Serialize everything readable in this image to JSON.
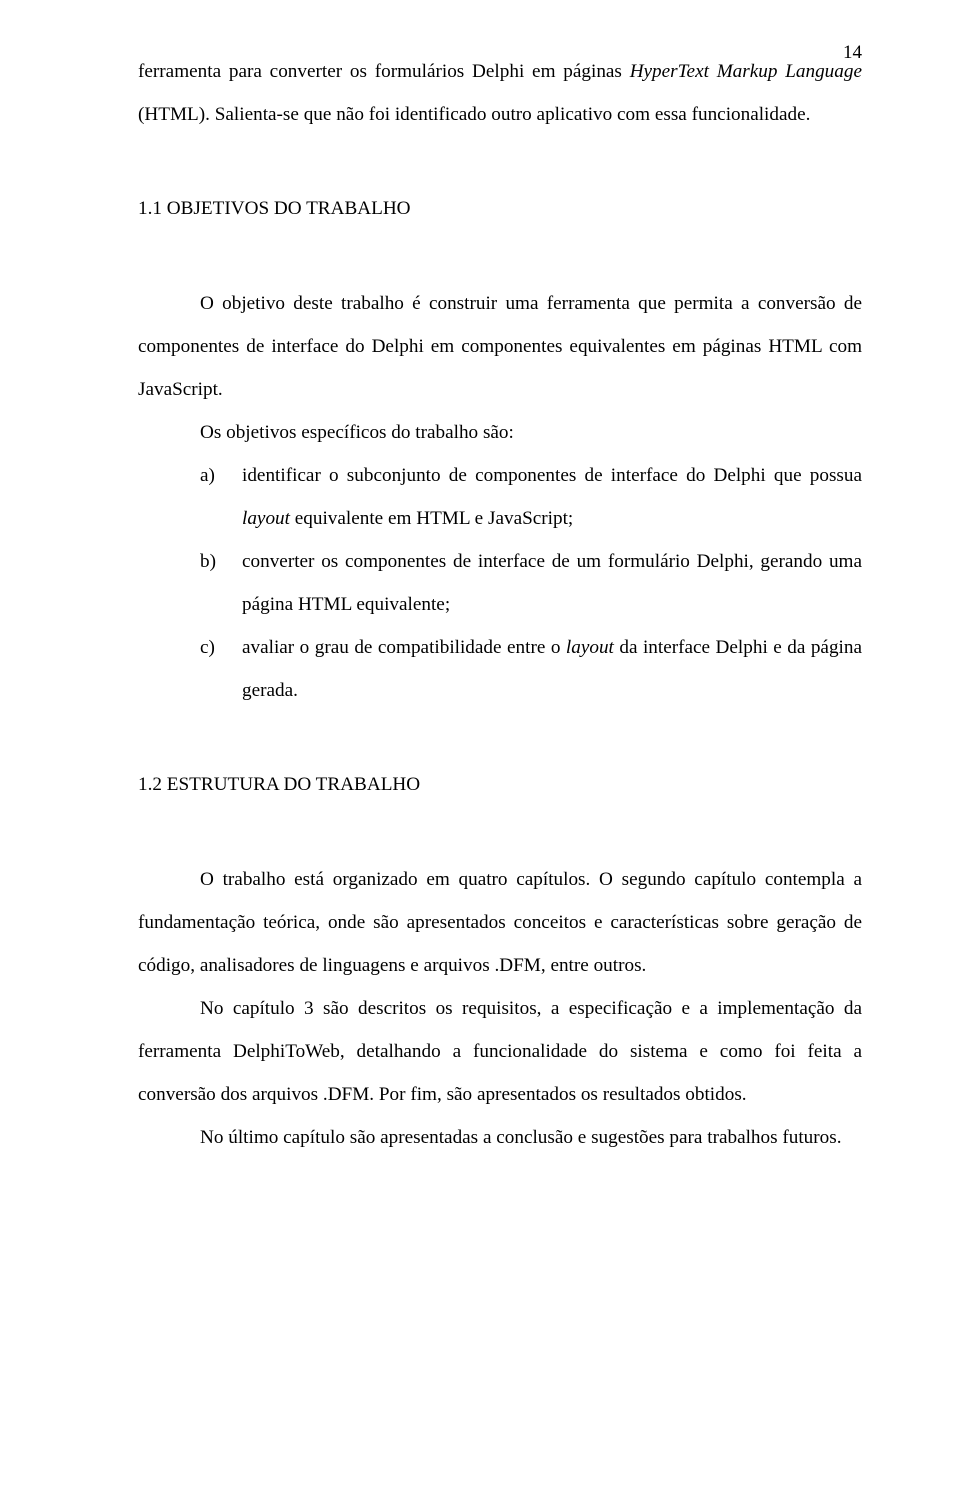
{
  "page_number": "14",
  "p1_a": "ferramenta para converter os formulários Delphi em páginas ",
  "p1_em": "HyperText Markup Language",
  "p1_b": " (HTML). Salienta-se que não foi identificado outro aplicativo com essa funcionalidade.",
  "h1": "1.1 OBJETIVOS DO TRABALHO",
  "p2": "O objetivo deste trabalho é construir uma ferramenta que permita a conversão de componentes de interface do Delphi em componentes equivalentes em páginas HTML com JavaScript.",
  "p3": "Os objetivos específicos do trabalho são:",
  "li_a_marker": "a)",
  "li_a_1": "identificar o subconjunto de componentes de interface do Delphi que possua ",
  "li_a_em": "layout",
  "li_a_2": " equivalente em HTML e JavaScript;",
  "li_b_marker": "b)",
  "li_b": "converter os componentes de interface de um formulário Delphi, gerando uma página HTML equivalente;",
  "li_c_marker": "c)",
  "li_c_1": "avaliar o grau de compatibilidade entre o ",
  "li_c_em": "layout",
  "li_c_2": " da interface Delphi e da página gerada.",
  "h2": "1.2 ESTRUTURA DO TRABALHO",
  "p4": "O trabalho está organizado em quatro capítulos. O segundo capítulo contempla a fundamentação teórica, onde são apresentados conceitos e características sobre geração de código, analisadores de linguagens e arquivos .DFM, entre outros.",
  "p5": "No capítulo 3 são descritos os requisitos, a especificação e a implementação da ferramenta DelphiToWeb, detalhando a funcionalidade do sistema e como foi feita a conversão dos arquivos .DFM. Por fim, são apresentados os resultados obtidos.",
  "p6": "No último capítulo são apresentadas a conclusão e sugestões para trabalhos futuros."
}
